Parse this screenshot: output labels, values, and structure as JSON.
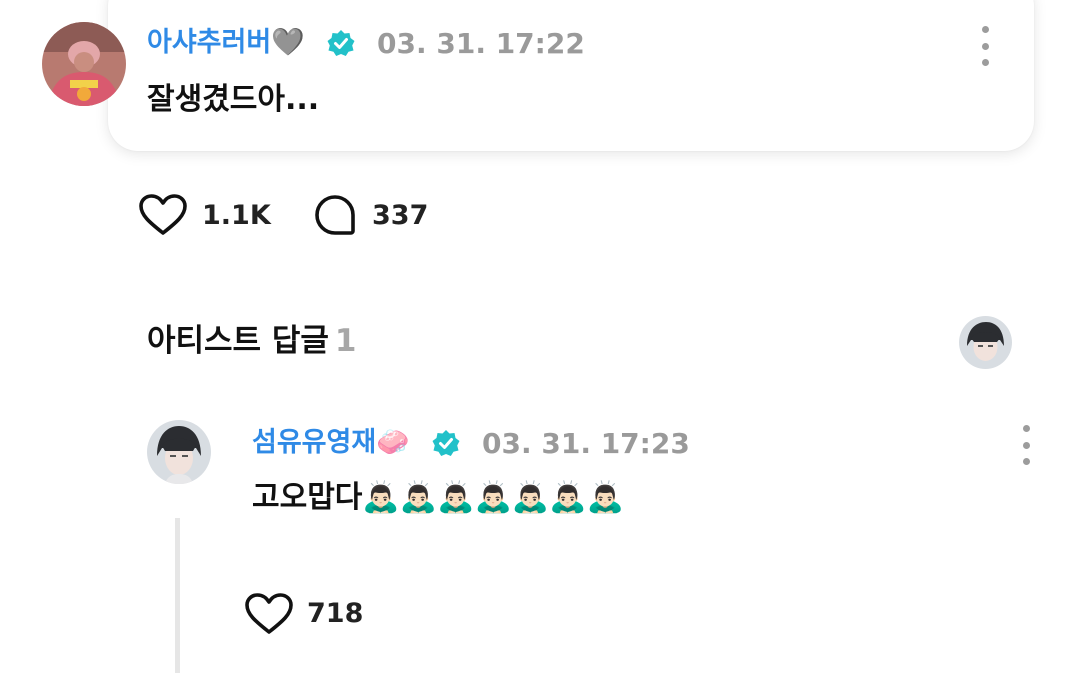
{
  "post": {
    "author": "아샤추러버🩶",
    "timestamp": "03. 31. 17:22",
    "text": "잘생겼드아...",
    "likes": "1.1K",
    "comments": "337"
  },
  "artist_replies": {
    "title": "아티스트 답글",
    "count": "1"
  },
  "reply": {
    "author": "섬유유영재🧼",
    "timestamp": "03. 31. 17:23",
    "text": "고오맙다🙇🏻‍♂️🙇🏻‍♂️🙇🏻‍♂️🙇🏻‍♂️🙇🏻‍♂️🙇🏻‍♂️🙇🏻‍♂️",
    "likes": "718"
  },
  "icons": {
    "verified": "verified-badge-icon",
    "like": "heart-icon",
    "comment": "speech-bubble-icon",
    "more": "more-vertical-icon"
  },
  "colors": {
    "name": "#2f8ae6",
    "verified": "#22c1c9",
    "timestamp": "#9a9a9a",
    "count_muted": "#a7a7a7"
  }
}
